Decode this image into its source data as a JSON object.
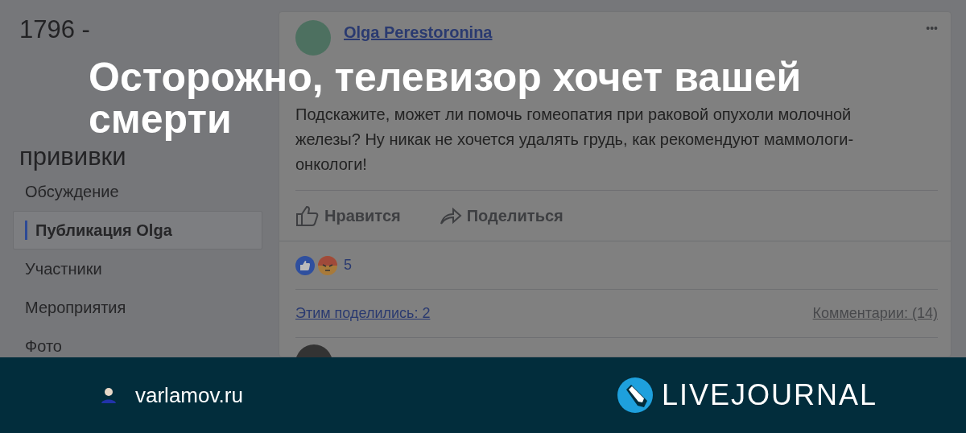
{
  "headline": {
    "lines": [
      "Осторожно, телевизор хочет вашей",
      "смерти"
    ]
  },
  "group": {
    "title_lines": [
      "1796 -",
      "прививки"
    ]
  },
  "sidebar": {
    "items": [
      {
        "label": "Обсуждение",
        "selected": false
      },
      {
        "label": "Публикация Olga",
        "selected": true
      },
      {
        "label": "Участники",
        "selected": false
      },
      {
        "label": "Мероприятия",
        "selected": false
      },
      {
        "label": "Фото",
        "selected": false
      }
    ]
  },
  "post": {
    "author": "Olga Perestoronina",
    "more": "•••",
    "text": "Подскажите, может ли помочь гомеопатия при раковой опухоли молочной железы? Ну никак не хочется удалять грудь, как рекомендуют маммологи-онкологи!",
    "actions": [
      {
        "kind": "like",
        "label": "Нравится"
      },
      {
        "kind": "share",
        "label": "Поделиться"
      }
    ],
    "reactions_count": "5",
    "shares": "Этим поделились: 2",
    "comments": "Комментарии: (14)"
  },
  "footer": {
    "site": "varlamov.ru",
    "brand": "LIVEJOURNAL"
  }
}
